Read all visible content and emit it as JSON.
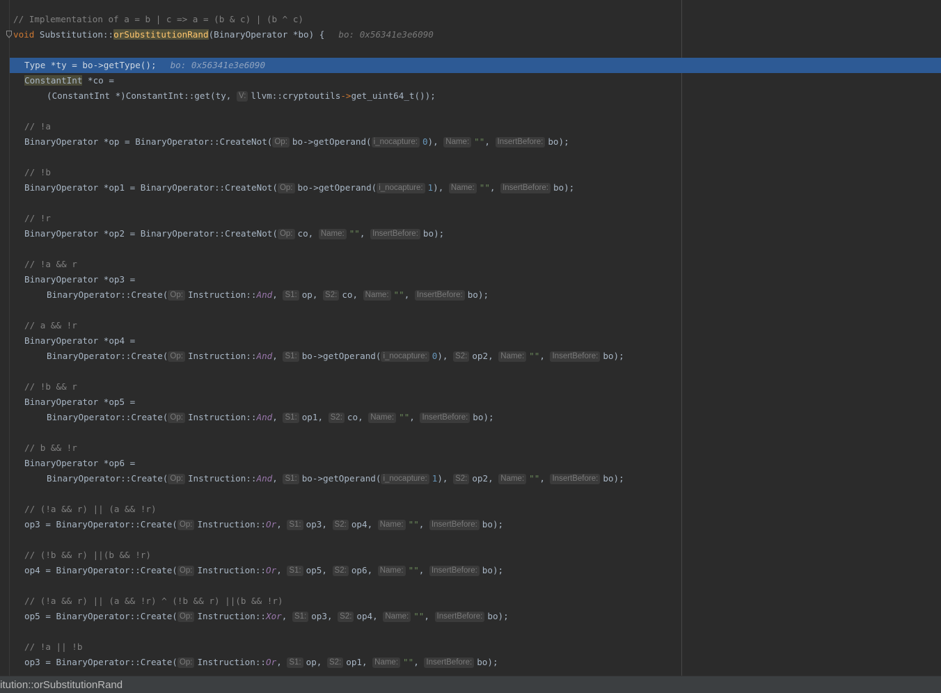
{
  "editor": {
    "comment_impl": "// Implementation of a = b | c => a = (b & c) | (b ^ c)",
    "fn_kw": "void",
    "fn_class": " Substitution::",
    "fn_name": "orSubstitutionRand",
    "fn_params": "(BinaryOperator *bo) {",
    "fn_inline_value": "bo: 0x56341e3e6090",
    "line_type": "Type *ty = bo->getType();",
    "line_type_inline_value": "bo: 0x56341e3e6090",
    "const_type": "ConstantInt",
    "const_rest": " *co =",
    "const_cast": "(ConstantInt *)ConstantInt::get(ty, ",
    "const_hint_v": "V:",
    "const_ns": "llvm::cryptoutils",
    "const_arrow": "->",
    "const_call": "get_uint64_t());",
    "comment_not_a": "// !a",
    "comment_not_b": "// !b",
    "comment_not_r": "// !r",
    "comment_nota_and_r": "// !a && r",
    "comment_a_and_notr": "// a && !r",
    "comment_notb_and_r": "// !b && r",
    "comment_b_and_notr": "// b && !r",
    "comment_or1": "// (!a && r) || (a && !r)",
    "comment_or2": "// (!b && r) ||(b && !r)",
    "comment_xor": "// (!a && r) || (a && !r) ^ (!b && r) ||(b && !r)",
    "comment_final_or": "// !a || !b",
    "decl_op": "BinaryOperator *op = BinaryOperator::CreateNot(",
    "decl_op1": "BinaryOperator *op1 = BinaryOperator::CreateNot(",
    "decl_op2": "BinaryOperator *op2 = BinaryOperator::CreateNot(",
    "decl_op3": "BinaryOperator *op3 =",
    "decl_op4": "BinaryOperator *op4 =",
    "decl_op5": "BinaryOperator *op5 =",
    "decl_op6": "BinaryOperator *op6 =",
    "create_call": "BinaryOperator::Create(",
    "assign_op3": "op3 = BinaryOperator::Create(",
    "assign_op4": "op4 = BinaryOperator::Create(",
    "assign_op5": "op5 = BinaryOperator::Create(",
    "instr_ns": "Instruction::",
    "instr_and": "And",
    "instr_or": "Or",
    "instr_xor": "Xor",
    "get_operand": "bo->getOperand(",
    "hints": {
      "op": "Op:",
      "s1": "S1:",
      "s2": "S2:",
      "name": "Name:",
      "insert_before": "InsertBefore:",
      "i_nocapture": "i_nocapture:"
    },
    "lit_0": "0",
    "lit_1": "1",
    "empty_str": "\"\"",
    "arg_bo_end": "bo);",
    "arg_co": "co",
    "arg_op": "op",
    "arg_op1": "op1",
    "arg_op2": "op2",
    "arg_op3": "op3",
    "arg_op4": "op4",
    "arg_op5": "op5",
    "arg_op6": "op6"
  },
  "breadcrumb": "titution::orSubstitutionRand"
}
